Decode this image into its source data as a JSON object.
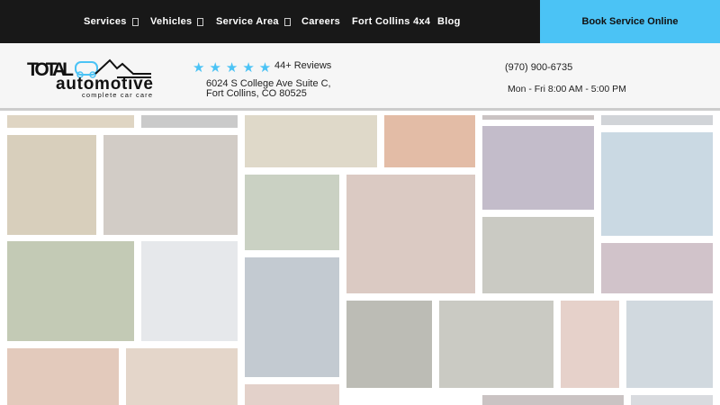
{
  "nav": {
    "items": [
      {
        "label": "Services",
        "has_dropdown": true
      },
      {
        "label": "Vehicles",
        "has_dropdown": true
      },
      {
        "label": "Service Area",
        "has_dropdown": true
      },
      {
        "label": "Careers",
        "has_dropdown": false
      },
      {
        "label": "Fort Collins 4x4",
        "has_dropdown": false
      },
      {
        "label": "Blog",
        "has_dropdown": false
      }
    ],
    "book_label": "Book Service Online"
  },
  "header": {
    "logo": {
      "line1": "TOTAL",
      "line2": "automotive",
      "tagline": "complete car care"
    },
    "rating": {
      "stars": 5,
      "reviews": "44+ Reviews"
    },
    "address_line1": "6024 S College Ave Suite C,",
    "address_line2": "Fort Collins, CO 80525",
    "phone": "(970) 900-6735",
    "hours": "Mon - Fri 8:00 AM - 5:00 PM"
  },
  "colors": {
    "accent": "#4bc3f5",
    "topbar": "#181818",
    "header_bg": "#f6f6f6"
  }
}
